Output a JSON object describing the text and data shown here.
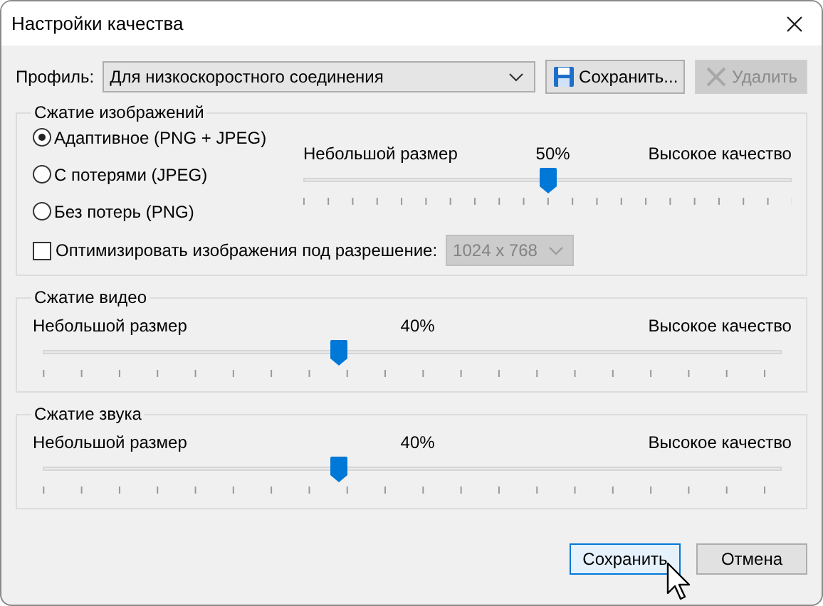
{
  "window": {
    "title": "Настройки качества"
  },
  "profile": {
    "label": "Профиль:",
    "value": "Для низкоскоростного соединения"
  },
  "toolbar_buttons": [
    {
      "kind": "save",
      "label": "Сохранить...",
      "disabled": false
    },
    {
      "kind": "delete",
      "label": "Удалить",
      "disabled": true
    }
  ],
  "image_compression": {
    "title": "Сжатие изображений",
    "options": [
      {
        "label": "Адаптивное (PNG + JPEG)",
        "selected": true
      },
      {
        "label": "С потерями (JPEG)",
        "selected": false
      },
      {
        "label": "Без потерь (PNG)",
        "selected": false
      }
    ],
    "slider": {
      "min_label": "Небольшой размер",
      "reading": "50%",
      "max_label": "Высокое качество",
      "level": 0.5
    },
    "optimize": {
      "label": "Оптимизировать изображения под разрешение:",
      "checked": false,
      "resolution": "1024 x 768",
      "resolution_disabled": true
    }
  },
  "video_compression": {
    "title": "Сжатие видео",
    "slider": {
      "min_label": "Небольшой размер",
      "reading": "40%",
      "max_label": "Высокое качество",
      "level": 0.4
    }
  },
  "audio_compression": {
    "title": "Сжатие звука",
    "slider": {
      "min_label": "Небольшой размер",
      "reading": "40%",
      "max_label": "Высокое качество",
      "level": 0.4
    }
  },
  "buttons": [
    {
      "label": "Сохранить",
      "default": true
    },
    {
      "label": "Отмена",
      "default": false
    }
  ]
}
